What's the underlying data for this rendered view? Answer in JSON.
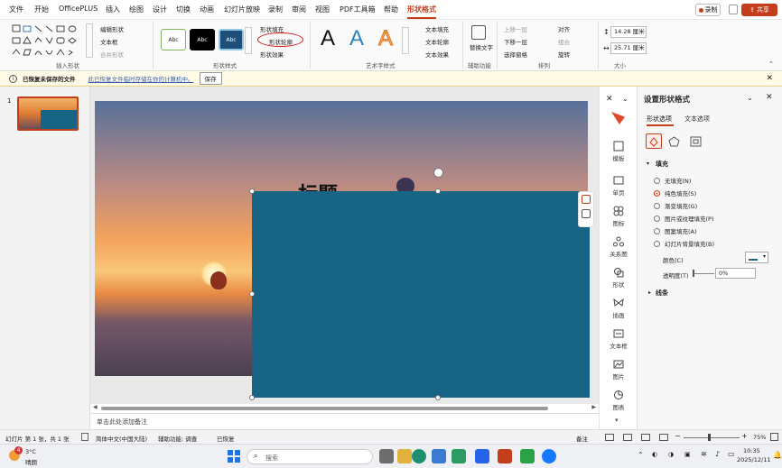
{
  "menu": {
    "tabs": [
      "文件",
      "开始",
      "OfficePLUS",
      "插入",
      "绘图",
      "设计",
      "切换",
      "动画",
      "幻灯片放映",
      "录制",
      "审阅",
      "视图",
      "PDF工具箱",
      "帮助",
      "形状格式"
    ],
    "active_tab": "形状格式",
    "record_label": "录制",
    "share_label": "共享"
  },
  "ribbon": {
    "insert_shapes": {
      "label": "插入形状",
      "edit_shape": "编辑形状",
      "text_box": "文本框",
      "merge_shapes": "合并形状"
    },
    "shape_styles": {
      "label": "形状样式",
      "styles": [
        "Abc",
        "Abc",
        "Abc"
      ],
      "fill": "形状填充",
      "outline": "形状轮廓",
      "effect": "形状效果"
    },
    "wordart": {
      "label": "艺术字样式",
      "letters": [
        "A",
        "A",
        "A"
      ],
      "text_fill": "文本填充",
      "text_outline": "文本轮廓",
      "text_effect": "文本效果"
    },
    "accessibility": {
      "label": "辅助功能",
      "alt_text": "替换文字"
    },
    "arrange": {
      "label": "排列",
      "bring_forward": "上移一层",
      "send_backward": "下移一层",
      "selection_pane": "选择窗格",
      "align": "对齐",
      "group": "组合",
      "rotate": "旋转"
    },
    "size": {
      "label": "大小",
      "height": "14.28 厘米",
      "width": "25.71 厘米"
    }
  },
  "infobar": {
    "title": "已恢复未保存的文件",
    "message": "此已恢复文件临时存储在你的计算机中。",
    "save_label": "保存"
  },
  "thumbnails": [
    {
      "number": "1"
    }
  ],
  "slide": {
    "title": "标题"
  },
  "notes_placeholder": "单击此处添加备注",
  "rail": [
    "模板",
    "单页",
    "图标",
    "关系图",
    "形状",
    "插画",
    "文本框",
    "图片",
    "图表"
  ],
  "pane": {
    "title": "设置形状格式",
    "tabs": [
      "形状选项",
      "文本选项"
    ],
    "active_tab": "形状选项",
    "fill_section": "填充",
    "fill_options": [
      "无填充(N)",
      "纯色填充(S)",
      "渐变填充(G)",
      "图片或纹理填充(P)",
      "图案填充(A)",
      "幻灯片背景填充(B)"
    ],
    "selected_fill": "纯色填充(S)",
    "color_label": "颜色(C)",
    "transparency_label": "透明度(T)",
    "transparency_value": "0%",
    "line_section": "线条",
    "fill_color": "#176484"
  },
  "status": {
    "slide_info": "幻灯片 第 1 张，共 1 张",
    "language": "简体中文(中国大陆)",
    "accessibility": "辅助功能: 调查",
    "recovered": "已恢复",
    "notes": "备注",
    "zoom": "75%"
  },
  "taskbar": {
    "weather_temp": "3°C",
    "weather_desc": "晴朗",
    "weather_badge": "4",
    "search_placeholder": "搜索",
    "time": "10:35",
    "date": "2025/12/11"
  },
  "colors": {
    "accent": "#c43e1c",
    "shape_fill": "#176484"
  }
}
